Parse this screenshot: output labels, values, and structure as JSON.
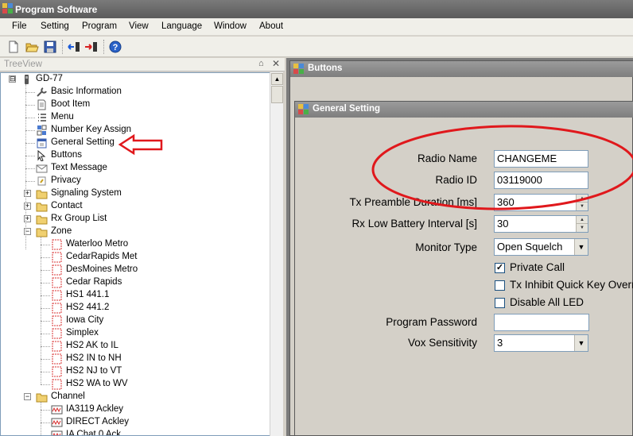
{
  "app": {
    "title": "Program Software"
  },
  "menu": [
    "File",
    "Setting",
    "Program",
    "View",
    "Language",
    "Window",
    "About"
  ],
  "toolbar": {
    "icons": [
      "new-icon",
      "open-icon",
      "save-icon",
      "read-radio-icon",
      "write-radio-icon",
      "help-icon"
    ]
  },
  "tree": {
    "header": "TreeView",
    "pin": "⌂",
    "close": "✕",
    "root": "GD-77",
    "items": [
      "Basic Information",
      "Boot Item",
      "Menu",
      "Number Key Assign",
      "General Setting",
      "Buttons",
      "Text Message",
      "Privacy",
      "Signaling System",
      "Contact",
      "Rx Group List",
      "Zone"
    ],
    "zones": [
      "Waterloo Metro",
      "CedarRapids Met",
      "DesMoines Metro",
      "Cedar Rapids",
      "HS1 441.1",
      "HS2 441.2",
      "Iowa City",
      "Simplex",
      "HS2 AK to IL",
      "HS2 IN to NH",
      "HS2 NJ to VT",
      "HS2 WA to WV"
    ],
    "channel_folder": "Channel",
    "channels": [
      "IA3119 Ackley",
      "DIRECT Ackley",
      "IA Chat 0 Ack"
    ]
  },
  "windows": {
    "buttons_title": "Buttons",
    "general_title": "General Setting"
  },
  "form": {
    "radio_name_label": "Radio Name",
    "radio_name_value": "CHANGEME",
    "radio_id_label": "Radio ID",
    "radio_id_value": "03119000",
    "tx_preamble_label": "Tx Preamble Duration [ms]",
    "tx_preamble_value": "360",
    "rx_low_battery_label": "Rx Low Battery Interval [s]",
    "rx_low_battery_value": "30",
    "monitor_type_label": "Monitor Type",
    "monitor_type_value": "Open Squelch",
    "private_call_label": "Private Call",
    "private_call_checked": true,
    "tx_inhibit_label": "Tx Inhibit Quick Key Override",
    "tx_inhibit_checked": false,
    "disable_led_label": "Disable All LED",
    "disable_led_checked": false,
    "program_password_label": "Program Password",
    "program_password_value": "",
    "vox_label": "Vox Sensitivity",
    "vox_value": "3"
  },
  "colors": {
    "annotation": "#e0181c",
    "titlebar": "#6b6b6b"
  }
}
